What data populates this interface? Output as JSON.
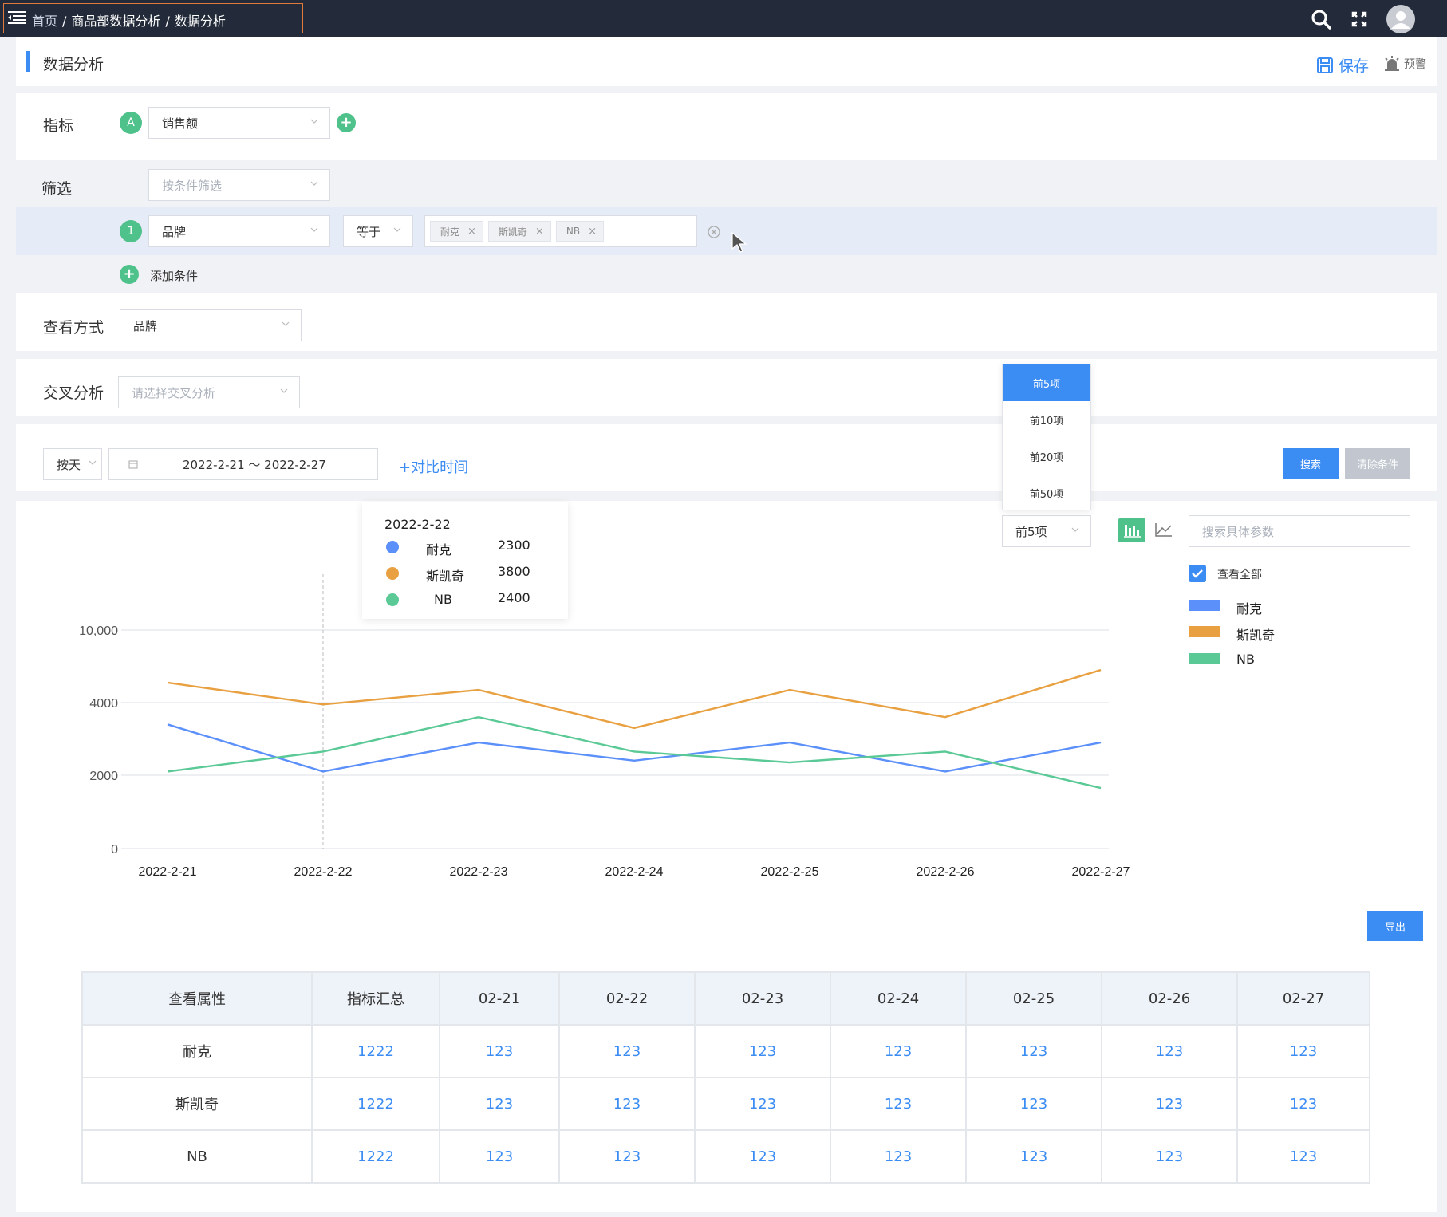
{
  "topbar": {
    "breadcrumb": [
      "首页",
      "商品部数据分析",
      "数据分析"
    ],
    "separator": "/"
  },
  "page_title": "数据分析",
  "actions": {
    "save": "保存",
    "alert": "预警"
  },
  "metric": {
    "label": "指标",
    "badge": "A",
    "value": "销售额"
  },
  "filter": {
    "label": "筛选",
    "placeholder": "按条件筛选",
    "condition": {
      "index": "1",
      "field": "品牌",
      "operator": "等于",
      "tags": [
        "耐克",
        "斯凯奇",
        "NB"
      ]
    },
    "add_label": "添加条件"
  },
  "view_mode": {
    "label": "查看方式",
    "value": "品牌"
  },
  "cross": {
    "label": "交叉分析",
    "placeholder": "请选择交叉分析"
  },
  "time": {
    "granularity": "按天",
    "range": "2022-2-21 ～ 2022-2-27",
    "compare": "+对比时间",
    "search_btn": "搜索",
    "clear_btn": "清除条件"
  },
  "topn": {
    "selected": "前5项",
    "options": [
      "前5项",
      "前10项",
      "前20项",
      "前50项"
    ]
  },
  "param_search_placeholder": "搜索具体参数",
  "legend": {
    "select_all": "查看全部",
    "items": [
      {
        "name": "耐克",
        "color": "#5b8ff9"
      },
      {
        "name": "斯凯奇",
        "color": "#e8a040"
      },
      {
        "name": "NB",
        "color": "#5ac996"
      }
    ]
  },
  "tooltip": {
    "date": "2022-2-22",
    "rows": [
      {
        "name": "耐克",
        "value": "2300"
      },
      {
        "name": "斯凯奇",
        "value": "3800"
      },
      {
        "name": "NB",
        "value": "2400"
      }
    ]
  },
  "chart_data": {
    "type": "line",
    "x": [
      "2022-2-21",
      "2022-2-22",
      "2022-2-23",
      "2022-2-24",
      "2022-2-25",
      "2022-2-26",
      "2022-2-27"
    ],
    "y_ticks": [
      "0",
      "2000",
      "4000",
      "10,000"
    ],
    "series": [
      {
        "name": "耐克",
        "color": "#5b8ff9",
        "values": [
          3400,
          2100,
          2900,
          2400,
          2900,
          2100,
          2900
        ]
      },
      {
        "name": "斯凯奇",
        "color": "#e8a040",
        "values": [
          4550,
          3950,
          4350,
          3300,
          4350,
          3600,
          4900
        ]
      },
      {
        "name": "NB",
        "color": "#5ac996",
        "values": [
          2100,
          2650,
          3600,
          2650,
          2350,
          2650,
          1650
        ]
      }
    ],
    "hover_index": 1
  },
  "export_btn": "导出",
  "table": {
    "headers": [
      "查看属性",
      "指标汇总",
      "02-21",
      "02-22",
      "02-23",
      "02-24",
      "02-25",
      "02-26",
      "02-27"
    ],
    "rows": [
      [
        "耐克",
        "1222",
        "123",
        "123",
        "123",
        "123",
        "123",
        "123",
        "123"
      ],
      [
        "斯凯奇",
        "1222",
        "123",
        "123",
        "123",
        "123",
        "123",
        "123",
        "123"
      ],
      [
        "NB",
        "1222",
        "123",
        "123",
        "123",
        "123",
        "123",
        "123",
        "123"
      ]
    ]
  }
}
